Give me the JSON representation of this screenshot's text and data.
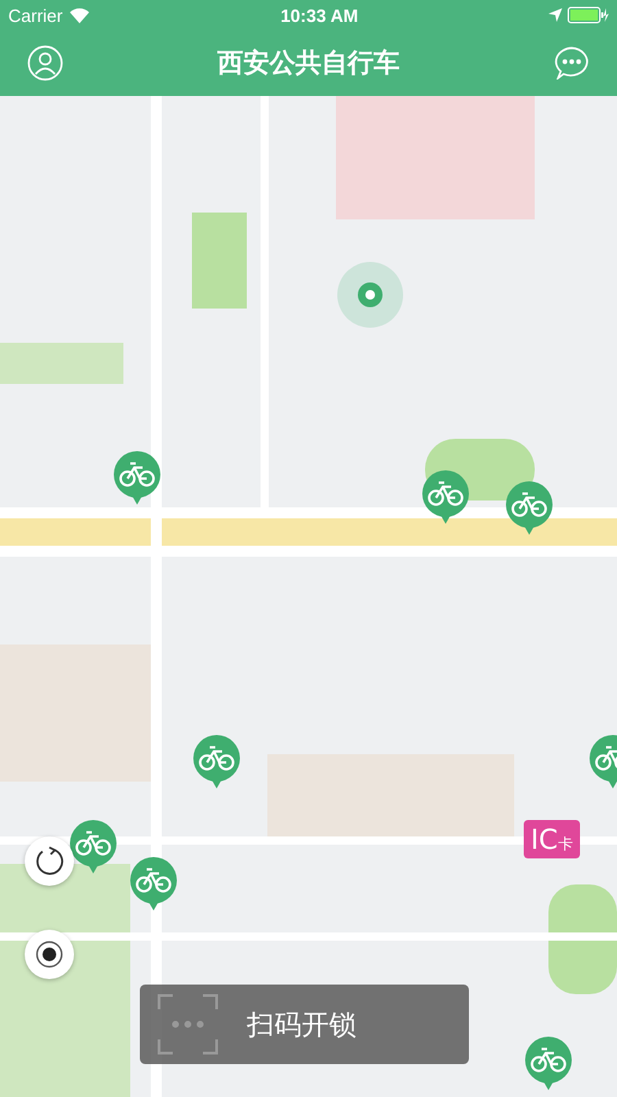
{
  "status_bar": {
    "carrier": "Carrier",
    "time": "10:33 AM"
  },
  "nav_bar": {
    "title": "西安公共自行车"
  },
  "ic_card_button": {
    "label": "IC",
    "suffix": "卡"
  },
  "scan_button": {
    "label": "扫码开锁"
  }
}
